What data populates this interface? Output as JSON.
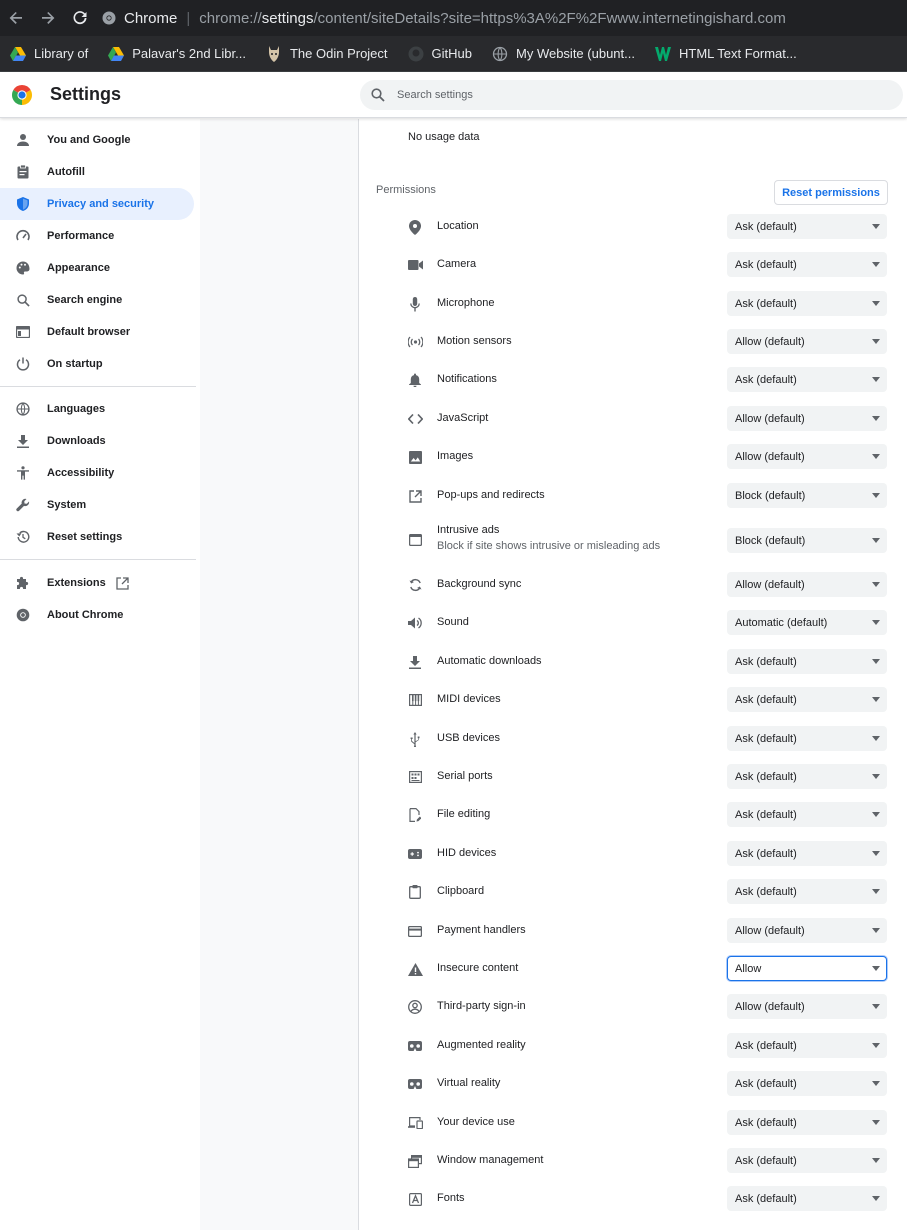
{
  "browser": {
    "url_scheme_label": "Chrome",
    "url_prefix": "chrome://",
    "url_host": "settings",
    "url_path": "/content/siteDetails?site=https%3A%2F%2Fwww.internetingishard.com"
  },
  "bookmarks": [
    {
      "label": "Library of",
      "icon": "google-drive-icon"
    },
    {
      "label": "Palavar's 2nd Libr...",
      "icon": "google-drive-icon"
    },
    {
      "label": "The Odin Project",
      "icon": "odin-project-icon"
    },
    {
      "label": "GitHub",
      "icon": "github-icon"
    },
    {
      "label": "My Website (ubunt...",
      "icon": "globe-icon"
    },
    {
      "label": "HTML Text Format...",
      "icon": "w3-icon"
    }
  ],
  "header": {
    "title": "Settings",
    "search_placeholder": "Search settings"
  },
  "sidebar": {
    "items": [
      {
        "label": "You and Google",
        "icon": "person-icon"
      },
      {
        "label": "Autofill",
        "icon": "clipboard-icon"
      },
      {
        "label": "Privacy and security",
        "icon": "shield-icon"
      },
      {
        "label": "Performance",
        "icon": "speedometer-icon"
      },
      {
        "label": "Appearance",
        "icon": "palette-icon"
      },
      {
        "label": "Search engine",
        "icon": "search-icon"
      },
      {
        "label": "Default browser",
        "icon": "browser-window-icon"
      },
      {
        "label": "On startup",
        "icon": "power-icon"
      },
      {
        "label": "Languages",
        "icon": "globe-icon"
      },
      {
        "label": "Downloads",
        "icon": "download-icon"
      },
      {
        "label": "Accessibility",
        "icon": "accessibility-icon"
      },
      {
        "label": "System",
        "icon": "wrench-icon"
      },
      {
        "label": "Reset settings",
        "icon": "history-icon"
      },
      {
        "label": "Extensions",
        "icon": "puzzle-icon"
      },
      {
        "label": "About Chrome",
        "icon": "chrome-icon"
      }
    ],
    "selected": "Privacy and security"
  },
  "main": {
    "usage_text": "No usage data",
    "permissions_heading": "Permissions",
    "reset_button": "Reset permissions",
    "permissions": [
      {
        "label": "Location",
        "value": "Ask (default)",
        "icon": "location-pin-icon"
      },
      {
        "label": "Camera",
        "value": "Ask (default)",
        "icon": "camera-icon"
      },
      {
        "label": "Microphone",
        "value": "Ask (default)",
        "icon": "microphone-icon"
      },
      {
        "label": "Motion sensors",
        "value": "Allow (default)",
        "icon": "sensors-icon"
      },
      {
        "label": "Notifications",
        "value": "Ask (default)",
        "icon": "bell-icon"
      },
      {
        "label": "JavaScript",
        "value": "Allow (default)",
        "icon": "code-icon"
      },
      {
        "label": "Images",
        "value": "Allow (default)",
        "icon": "image-icon"
      },
      {
        "label": "Pop-ups and redirects",
        "value": "Block (default)",
        "icon": "open-in-new-icon"
      },
      {
        "label": "Intrusive ads",
        "sublabel": "Block if site shows intrusive or misleading ads",
        "value": "Block (default)",
        "icon": "web-asset-icon"
      },
      {
        "label": "Background sync",
        "value": "Allow (default)",
        "icon": "sync-icon"
      },
      {
        "label": "Sound",
        "value": "Automatic (default)",
        "icon": "volume-icon"
      },
      {
        "label": "Automatic downloads",
        "value": "Ask (default)",
        "icon": "download-icon"
      },
      {
        "label": "MIDI devices",
        "value": "Ask (default)",
        "icon": "piano-icon"
      },
      {
        "label": "USB devices",
        "value": "Ask (default)",
        "icon": "usb-icon"
      },
      {
        "label": "Serial ports",
        "value": "Ask (default)",
        "icon": "serial-port-icon"
      },
      {
        "label": "File editing",
        "value": "Ask (default)",
        "icon": "file-edit-icon"
      },
      {
        "label": "HID devices",
        "value": "Ask (default)",
        "icon": "gamepad-icon"
      },
      {
        "label": "Clipboard",
        "value": "Ask (default)",
        "icon": "clipboard-icon"
      },
      {
        "label": "Payment handlers",
        "value": "Allow (default)",
        "icon": "credit-card-icon"
      },
      {
        "label": "Insecure content",
        "value": "Allow",
        "icon": "warning-icon",
        "focused": true
      },
      {
        "label": "Third-party sign-in",
        "value": "Allow (default)",
        "icon": "account-circle-icon"
      },
      {
        "label": "Augmented reality",
        "value": "Ask (default)",
        "icon": "vr-headset-icon"
      },
      {
        "label": "Virtual reality",
        "value": "Ask (default)",
        "icon": "vr-headset-icon"
      },
      {
        "label": "Your device use",
        "value": "Ask (default)",
        "icon": "devices-icon"
      },
      {
        "label": "Window management",
        "value": "Ask (default)",
        "icon": "window-stack-icon"
      },
      {
        "label": "Fonts",
        "value": "Ask (default)",
        "icon": "font-icon"
      }
    ]
  },
  "colors": {
    "accent": "#1a73e8",
    "selected_bg": "#e8f0fe",
    "browser_dark": "#202124"
  }
}
